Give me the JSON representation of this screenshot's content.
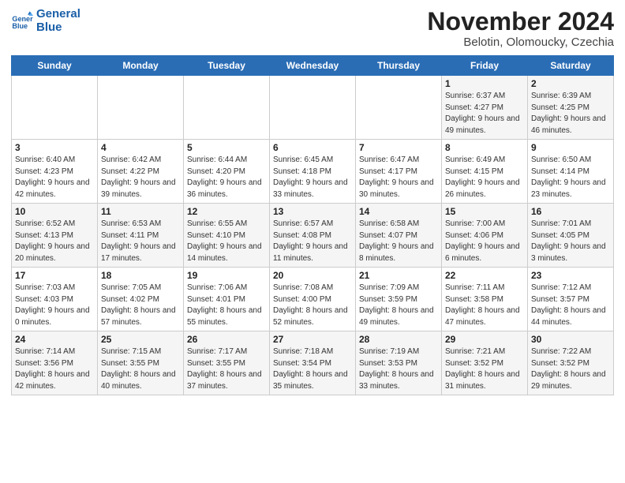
{
  "logo": {
    "line1": "General",
    "line2": "Blue"
  },
  "title": "November 2024",
  "subtitle": "Belotin, Olomoucky, Czechia",
  "weekdays": [
    "Sunday",
    "Monday",
    "Tuesday",
    "Wednesday",
    "Thursday",
    "Friday",
    "Saturday"
  ],
  "weeks": [
    [
      {
        "day": "",
        "info": ""
      },
      {
        "day": "",
        "info": ""
      },
      {
        "day": "",
        "info": ""
      },
      {
        "day": "",
        "info": ""
      },
      {
        "day": "",
        "info": ""
      },
      {
        "day": "1",
        "info": "Sunrise: 6:37 AM\nSunset: 4:27 PM\nDaylight: 9 hours\nand 49 minutes."
      },
      {
        "day": "2",
        "info": "Sunrise: 6:39 AM\nSunset: 4:25 PM\nDaylight: 9 hours\nand 46 minutes."
      }
    ],
    [
      {
        "day": "3",
        "info": "Sunrise: 6:40 AM\nSunset: 4:23 PM\nDaylight: 9 hours\nand 42 minutes."
      },
      {
        "day": "4",
        "info": "Sunrise: 6:42 AM\nSunset: 4:22 PM\nDaylight: 9 hours\nand 39 minutes."
      },
      {
        "day": "5",
        "info": "Sunrise: 6:44 AM\nSunset: 4:20 PM\nDaylight: 9 hours\nand 36 minutes."
      },
      {
        "day": "6",
        "info": "Sunrise: 6:45 AM\nSunset: 4:18 PM\nDaylight: 9 hours\nand 33 minutes."
      },
      {
        "day": "7",
        "info": "Sunrise: 6:47 AM\nSunset: 4:17 PM\nDaylight: 9 hours\nand 30 minutes."
      },
      {
        "day": "8",
        "info": "Sunrise: 6:49 AM\nSunset: 4:15 PM\nDaylight: 9 hours\nand 26 minutes."
      },
      {
        "day": "9",
        "info": "Sunrise: 6:50 AM\nSunset: 4:14 PM\nDaylight: 9 hours\nand 23 minutes."
      }
    ],
    [
      {
        "day": "10",
        "info": "Sunrise: 6:52 AM\nSunset: 4:13 PM\nDaylight: 9 hours\nand 20 minutes."
      },
      {
        "day": "11",
        "info": "Sunrise: 6:53 AM\nSunset: 4:11 PM\nDaylight: 9 hours\nand 17 minutes."
      },
      {
        "day": "12",
        "info": "Sunrise: 6:55 AM\nSunset: 4:10 PM\nDaylight: 9 hours\nand 14 minutes."
      },
      {
        "day": "13",
        "info": "Sunrise: 6:57 AM\nSunset: 4:08 PM\nDaylight: 9 hours\nand 11 minutes."
      },
      {
        "day": "14",
        "info": "Sunrise: 6:58 AM\nSunset: 4:07 PM\nDaylight: 9 hours\nand 8 minutes."
      },
      {
        "day": "15",
        "info": "Sunrise: 7:00 AM\nSunset: 4:06 PM\nDaylight: 9 hours\nand 6 minutes."
      },
      {
        "day": "16",
        "info": "Sunrise: 7:01 AM\nSunset: 4:05 PM\nDaylight: 9 hours\nand 3 minutes."
      }
    ],
    [
      {
        "day": "17",
        "info": "Sunrise: 7:03 AM\nSunset: 4:03 PM\nDaylight: 9 hours\nand 0 minutes."
      },
      {
        "day": "18",
        "info": "Sunrise: 7:05 AM\nSunset: 4:02 PM\nDaylight: 8 hours\nand 57 minutes."
      },
      {
        "day": "19",
        "info": "Sunrise: 7:06 AM\nSunset: 4:01 PM\nDaylight: 8 hours\nand 55 minutes."
      },
      {
        "day": "20",
        "info": "Sunrise: 7:08 AM\nSunset: 4:00 PM\nDaylight: 8 hours\nand 52 minutes."
      },
      {
        "day": "21",
        "info": "Sunrise: 7:09 AM\nSunset: 3:59 PM\nDaylight: 8 hours\nand 49 minutes."
      },
      {
        "day": "22",
        "info": "Sunrise: 7:11 AM\nSunset: 3:58 PM\nDaylight: 8 hours\nand 47 minutes."
      },
      {
        "day": "23",
        "info": "Sunrise: 7:12 AM\nSunset: 3:57 PM\nDaylight: 8 hours\nand 44 minutes."
      }
    ],
    [
      {
        "day": "24",
        "info": "Sunrise: 7:14 AM\nSunset: 3:56 PM\nDaylight: 8 hours\nand 42 minutes."
      },
      {
        "day": "25",
        "info": "Sunrise: 7:15 AM\nSunset: 3:55 PM\nDaylight: 8 hours\nand 40 minutes."
      },
      {
        "day": "26",
        "info": "Sunrise: 7:17 AM\nSunset: 3:55 PM\nDaylight: 8 hours\nand 37 minutes."
      },
      {
        "day": "27",
        "info": "Sunrise: 7:18 AM\nSunset: 3:54 PM\nDaylight: 8 hours\nand 35 minutes."
      },
      {
        "day": "28",
        "info": "Sunrise: 7:19 AM\nSunset: 3:53 PM\nDaylight: 8 hours\nand 33 minutes."
      },
      {
        "day": "29",
        "info": "Sunrise: 7:21 AM\nSunset: 3:52 PM\nDaylight: 8 hours\nand 31 minutes."
      },
      {
        "day": "30",
        "info": "Sunrise: 7:22 AM\nSunset: 3:52 PM\nDaylight: 8 hours\nand 29 minutes."
      }
    ]
  ]
}
